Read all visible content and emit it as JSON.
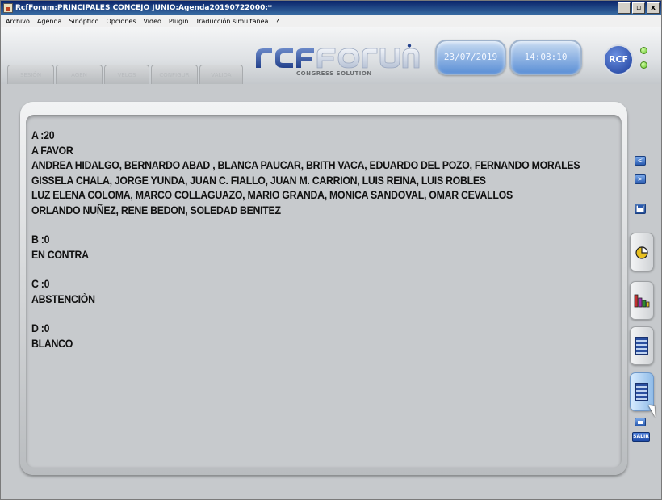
{
  "window": {
    "title": "RcfForum:PRINCIPALES CONCEJO JUNIO:Agenda20190722000:*",
    "controls": [
      "_",
      "▫",
      "x"
    ]
  },
  "menu": {
    "items": [
      "Archivo",
      "Agenda",
      "Sinóptico",
      "Opciones",
      "Video",
      "Plugin",
      "Traducción simultanea",
      "?"
    ]
  },
  "header": {
    "tabs": [
      "SESIÓN",
      "AGEN",
      "VELOS",
      "CONFIGUR",
      "VALIDA"
    ],
    "logo_text": "rcfforum",
    "logo_subtitle": "CONGRESS SOLUTION",
    "date": "23/07/2019",
    "time": "14:08:10",
    "badge": "RCF"
  },
  "results": {
    "a_label": "A :20",
    "a_title": "A FAVOR",
    "a_names": [
      "ANDREA HIDALGO, BERNARDO ABAD , BLANCA PAUCAR, BRITH VACA, EDUARDO DEL POZO, FERNANDO MORALES",
      "GISSELA CHALA, JORGE YUNDA, JUAN C. FIALLO, JUAN M. CARRION, LUIS REINA, LUIS ROBLES",
      "LUZ ELENA COLOMA, MARCO COLLAGUAZO, MARIO GRANDA, MONICA SANDOVAL, OMAR CEVALLOS",
      "ORLANDO NUÑEZ, RENE BEDON, SOLEDAD BENITEZ"
    ],
    "b_label": "B :0",
    "b_title": "EN CONTRA",
    "c_label": "C :0",
    "c_title": "ABSTENCIÒN",
    "d_label": "D :0",
    "d_title": "BLANCO"
  },
  "sidebar": {
    "prev_glyph": "<",
    "next_glyph": ">",
    "exit_label": "SALIR"
  },
  "colors": {
    "accent_blue": "#5b8fd6",
    "led_green": "#5cc020",
    "badge_blue": "#1c3d9a"
  }
}
